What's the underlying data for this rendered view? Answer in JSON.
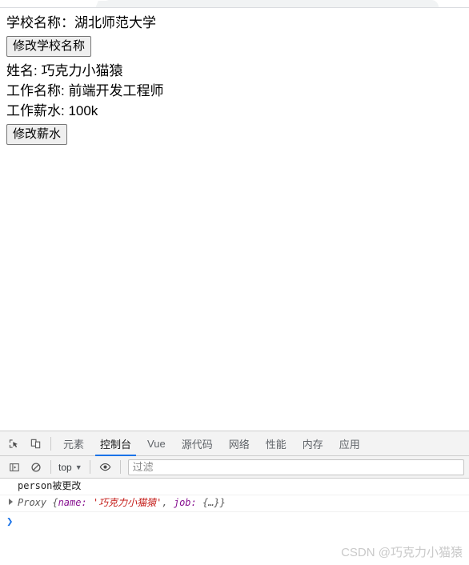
{
  "browser": {
    "tab_strip_visible": true
  },
  "page": {
    "lines": [
      {
        "id": "school",
        "text": "学校名称：湖北师范大学"
      },
      {
        "id": "name",
        "text": "姓名: 巧克力小猫猿"
      },
      {
        "id": "job_title",
        "text": "工作名称: 前端开发工程师"
      },
      {
        "id": "salary",
        "text": "工作薪水: 100k"
      }
    ],
    "buttons": {
      "change_school": "修改学校名称",
      "change_salary": "修改薪水"
    }
  },
  "devtools": {
    "toolbar_icons": [
      {
        "name": "inspect-element-icon",
        "glyph": "inspect"
      },
      {
        "name": "device-toolbar-icon",
        "glyph": "device"
      }
    ],
    "tabs": [
      {
        "label": "元素",
        "active": false
      },
      {
        "label": "控制台",
        "active": true
      },
      {
        "label": "Vue",
        "active": false
      },
      {
        "label": "源代码",
        "active": false
      },
      {
        "label": "网络",
        "active": false
      },
      {
        "label": "性能",
        "active": false
      },
      {
        "label": "内存",
        "active": false
      },
      {
        "label": "应用",
        "active": false
      }
    ],
    "active_tab": "控制台",
    "accent_color": "#1a73e8",
    "filter_bar": {
      "sidebar_toggle_icon": "console-sidebar-icon",
      "clear_console_icon": "clear-console-icon",
      "context_label": "top",
      "context_caret": "▼",
      "eye_icon": "live-expression-eye-icon",
      "filter_placeholder": "过滤",
      "filter_value": ""
    },
    "console": {
      "messages": [
        {
          "type": "log",
          "text": "person被更改"
        },
        {
          "type": "object",
          "expandable": true,
          "prefix": "Proxy",
          "open_brace": " {",
          "key1": "name:",
          "value1": "'巧克力小猫猿'",
          "comma": ", ",
          "key2": "job:",
          "value2": "{…}",
          "close_brace": "}"
        }
      ],
      "prompt_caret": "❯",
      "prompt_value": ""
    }
  },
  "watermark": {
    "text": "CSDN @巧克力小猫猿"
  }
}
